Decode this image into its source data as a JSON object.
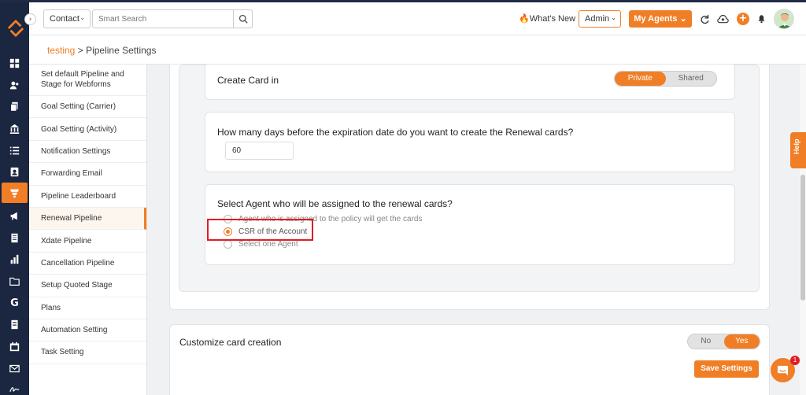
{
  "topbar": {
    "contact_select": "Contact",
    "search_placeholder": "Smart Search",
    "whats_new": "What's New",
    "admin_select": "Admin",
    "my_agents": "My Agents"
  },
  "breadcrumb": {
    "parent": "testing",
    "separator": ">",
    "current": "Pipeline Settings"
  },
  "settings_list": [
    "Set default Pipeline and Stage for Webforms",
    "Goal Setting (Carrier)",
    "Goal Setting (Activity)",
    "Notification Settings",
    "Forwarding Email",
    "Pipeline Leaderboard",
    "Renewal Pipeline",
    "Xdate Pipeline",
    "Cancellation Pipeline",
    "Setup Quoted Stage",
    "Plans",
    "Automation Setting",
    "Task Setting"
  ],
  "active_setting_index": 6,
  "create_card": {
    "title": "Create Card in",
    "options": [
      "Private",
      "Shared"
    ],
    "selected": "Private"
  },
  "renewal_days": {
    "question": "How many days before the expiration date do you want to create the Renewal cards?",
    "value": "60"
  },
  "assign_agent": {
    "question": "Select Agent who will be assigned to the renewal cards?",
    "options": [
      "Agent who is assigned to the policy will get the cards",
      "CSR of the Account",
      "Select one Agent"
    ],
    "selected_index": 1
  },
  "customize": {
    "label": "Customize card creation",
    "options": [
      "No",
      "Yes"
    ],
    "selected": "Yes"
  },
  "save_button": "Save Settings",
  "help_tab": "Help",
  "chat_badge": "1",
  "colors": {
    "accent": "#f07e26",
    "rail": "#1b2640",
    "highlight": "#e21c23"
  }
}
